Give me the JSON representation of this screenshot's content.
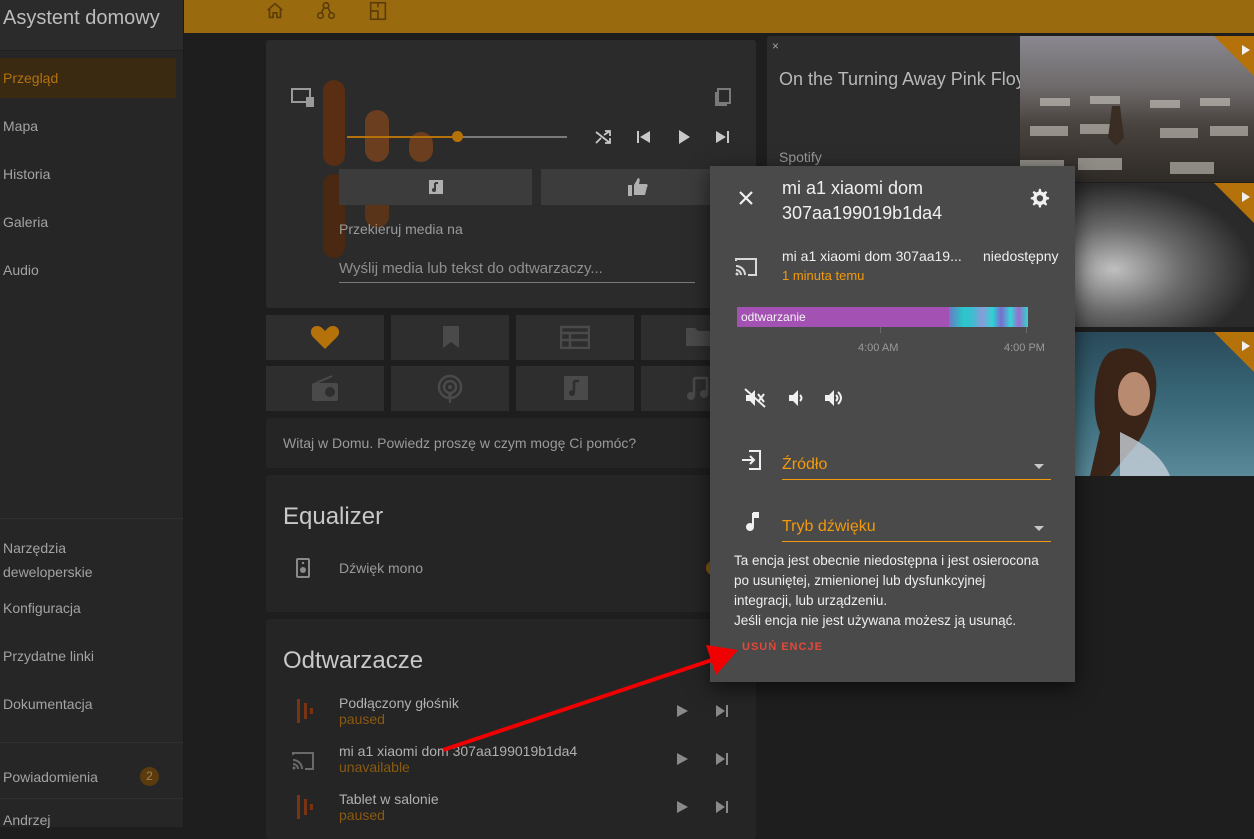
{
  "sidebar": {
    "title": "Asystent domowy",
    "items": [
      {
        "label": "Przegląd",
        "active": true
      },
      {
        "label": "Mapa"
      },
      {
        "label": "Historia"
      },
      {
        "label": "Galeria"
      },
      {
        "label": "Audio"
      }
    ],
    "bottom_items": [
      {
        "label_line1": "Narzędzia",
        "label_line2": "deweloperskie"
      },
      {
        "label": "Konfiguracja"
      },
      {
        "label": "Przydatne linki"
      },
      {
        "label": "Dokumentacja"
      }
    ],
    "notifications": {
      "label": "Powiadomienia",
      "count": "2"
    },
    "user": "Andrzej"
  },
  "colors": {
    "accent": "#f29a0b",
    "header": "#9a6a0e",
    "active_item": "#b5720b",
    "dialog_bg": "#4a4a4a",
    "danger": "#e04a3a",
    "history_playing": "#a352b3"
  },
  "media_card": {
    "redirect_label": "Przekieruj media na",
    "send_placeholder": "Wyślij media lub tekst do odtwarzaczy..."
  },
  "assistant_card": {
    "text": "Witaj w Domu. Powiedz proszę w czym mogę Ci pomóc?"
  },
  "equalizer": {
    "title": "Equalizer",
    "mono_label": "Dźwięk mono"
  },
  "players": {
    "title": "Odtwarzacze",
    "items": [
      {
        "name": "Podłączony głośnik",
        "state": "paused"
      },
      {
        "name": "mi a1 xiaomi dom 307aa199019b1da4",
        "state": "unavailable"
      },
      {
        "name": "Tablet w salonie",
        "state": "paused"
      }
    ]
  },
  "now_playing": {
    "title": "On the Turning Away Pink Floyd",
    "source": "Spotify",
    "close": "×"
  },
  "dialog": {
    "title_line1": "mi a1 xiaomi dom",
    "title_line2": "307aa199019b1da4",
    "entity_name": "mi a1 xiaomi dom 307aa19...",
    "entity_state": "niedostępny",
    "last_changed": "1 minuta temu",
    "history_label": "odtwarzanie",
    "time_ticks": [
      "4:00 AM",
      "4:00 PM"
    ],
    "source_label": "Źródło",
    "sound_mode_label": "Tryb dźwięku",
    "warning_lines": [
      "Ta encja jest obecnie niedostępna i jest osierocona",
      "po usuniętej, zmienionej lub dysfunkcyjnej",
      "integracji, lub urządzeniu.",
      "Jeśli encja nie jest używana możesz ją usunąć."
    ],
    "delete_button": "USUŃ ENCJE"
  }
}
